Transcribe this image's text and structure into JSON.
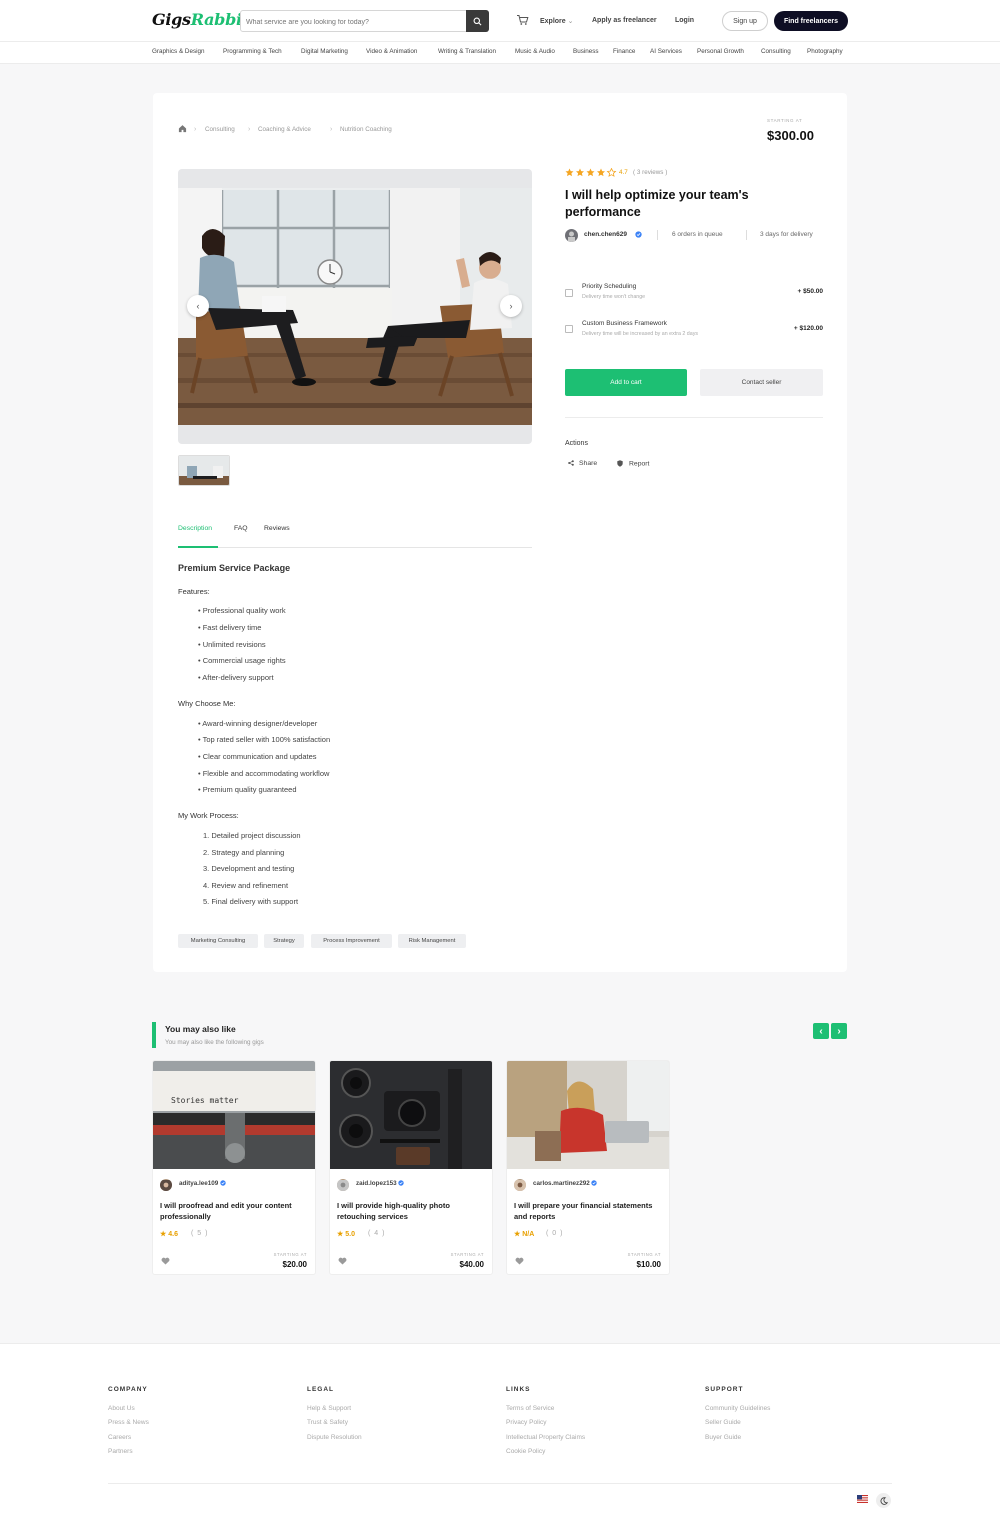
{
  "header": {
    "logo_part1": "Gigs",
    "logo_part2": "Rabbit",
    "search_placeholder": "What service are you looking for today?",
    "explore": "Explore",
    "apply": "Apply as freelancer",
    "login": "Login",
    "signup": "Sign up",
    "find": "Find freelancers"
  },
  "categories": [
    "Graphics & Design",
    "Programming & Tech",
    "Digital Marketing",
    "Video & Animation",
    "Writing & Translation",
    "Music & Audio",
    "Business",
    "Finance",
    "AI Services",
    "Personal Growth",
    "Consulting",
    "Photography"
  ],
  "breadcrumb": [
    "Consulting",
    "Coaching & Advice",
    "Nutrition Coaching"
  ],
  "gig": {
    "starting_at": "STARTING AT",
    "price": "$300.00",
    "rating": "4.7",
    "reviews": "( 3 reviews )",
    "title": "I will help optimize your team's performance",
    "seller": "chen.chen629",
    "orders": "6 orders in queue",
    "delivery": "3 days for delivery"
  },
  "addons": [
    {
      "title": "Priority Scheduling",
      "note": "Delivery time won't change",
      "price": "+ $50.00"
    },
    {
      "title": "Custom Business Framework",
      "note": "Delivery time will be increased by an extra 2 days",
      "price": "+ $120.00"
    }
  ],
  "buttons": {
    "add_to_cart": "Add to cart",
    "contact": "Contact seller"
  },
  "actions": {
    "label": "Actions",
    "share": "Share",
    "report": "Report"
  },
  "tabs": [
    "Description",
    "FAQ",
    "Reviews"
  ],
  "description": {
    "heading": "Premium Service Package",
    "features_label": "Features:",
    "features": [
      "• Professional quality work",
      "• Fast delivery time",
      "• Unlimited revisions",
      "• Commercial usage rights",
      "• After-delivery support"
    ],
    "why_label": "Why Choose Me:",
    "why": [
      "• Award-winning designer/developer",
      "• Top rated seller with 100% satisfaction",
      "• Clear communication and updates",
      "• Flexible and accommodating workflow",
      "• Premium quality guaranteed"
    ],
    "process_label": "My Work Process:",
    "process": [
      "1. Detailed project discussion",
      "2. Strategy and planning",
      "3. Development and testing",
      "4. Review and refinement",
      "5. Final delivery with support"
    ]
  },
  "tags": [
    "Marketing Consulting",
    "Strategy",
    "Process Improvement",
    "Risk Management"
  ],
  "related": {
    "title": "You may also like",
    "subtitle": "You may also like the following gigs",
    "cards": [
      {
        "user": "aditya.lee109",
        "title": "I will proofread and edit your content professionally",
        "rating": "4.6",
        "count": "( 5 )",
        "starting": "STARTING AT",
        "price": "$20.00",
        "image_text": "Stories matter"
      },
      {
        "user": "zaid.lopez153",
        "title": "I will provide high-quality photo retouching services",
        "rating": "5.0",
        "count": "( 4 )",
        "starting": "STARTING AT",
        "price": "$40.00"
      },
      {
        "user": "carlos.martinez292",
        "title": "I will prepare your financial statements and reports",
        "rating": "N/A",
        "count": "( 0 )",
        "starting": "STARTING AT",
        "price": "$10.00"
      }
    ]
  },
  "footer": {
    "company": {
      "heading": "COMPANY",
      "links": [
        "About Us",
        "Press & News",
        "Careers",
        "Partners"
      ]
    },
    "legal": {
      "heading": "LEGAL",
      "links": [
        "Help & Support",
        "Trust & Safety",
        "Dispute Resolution"
      ]
    },
    "links": {
      "heading": "LINKS",
      "links": [
        "Terms of Service",
        "Privacy Policy",
        "Intellectual Property Claims",
        "Cookie Policy"
      ]
    },
    "support": {
      "heading": "SUPPORT",
      "links": [
        "Community Guidelines",
        "Seller Guide",
        "Buyer Guide"
      ]
    }
  },
  "colors": {
    "accent": "#1dbf73",
    "dark": "#0e0e24",
    "star": "#f5a623"
  }
}
